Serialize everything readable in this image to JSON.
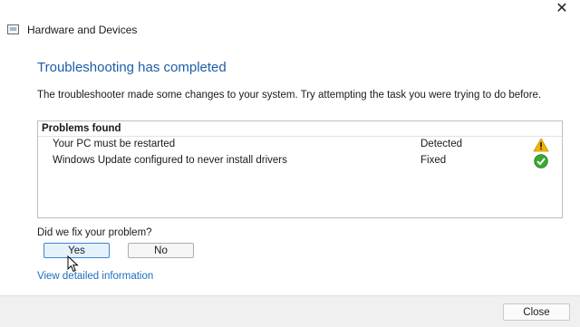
{
  "window": {
    "title": "Hardware and Devices",
    "close_glyph": "✕"
  },
  "main": {
    "heading": "Troubleshooting has completed",
    "description": "The troubleshooter made some changes to your system. Try attempting the task you were trying to do before.",
    "problems_header": "Problems found",
    "problems": [
      {
        "name": "Your PC must be restarted",
        "status": "Detected",
        "icon": "warning-icon"
      },
      {
        "name": "Windows Update configured to never install drivers",
        "status": "Fixed",
        "icon": "check-icon"
      }
    ],
    "question": "Did we fix your problem?",
    "yes_label": "Yes",
    "no_label": "No",
    "details_link": "View detailed information"
  },
  "footer": {
    "close_label": "Close"
  },
  "colors": {
    "heading": "#1d5da8",
    "link": "#1d6fbd",
    "warning": "#f2b400",
    "success": "#3aa836"
  }
}
